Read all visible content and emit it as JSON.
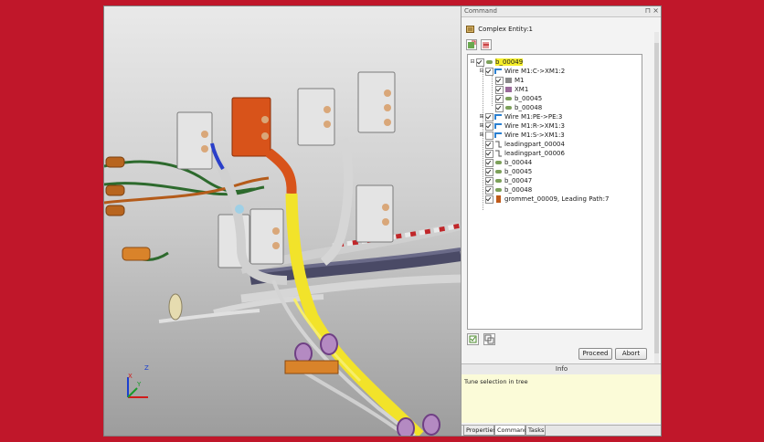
{
  "panel": {
    "title": "Command",
    "pin_icon": "pin-icon",
    "close_icon": "close-icon",
    "entity_label": "Complex Entity:1",
    "tree": [
      {
        "label": "b_00049",
        "selected": true
      },
      {
        "label": "Wire M1:C->XM1:2"
      },
      {
        "label": "M1"
      },
      {
        "label": "XM1"
      },
      {
        "label": "b_00045"
      },
      {
        "label": "b_00048"
      },
      {
        "label": "Wire M1:PE->PE:3"
      },
      {
        "label": "Wire M1:R->XM1:3"
      },
      {
        "label": "Wire M1:S->XM1:3"
      },
      {
        "label": "leadingpart_00004"
      },
      {
        "label": "leadingpart_00006"
      },
      {
        "label": "b_00044"
      },
      {
        "label": "b_00045"
      },
      {
        "label": "b_00047"
      },
      {
        "label": "b_00048"
      },
      {
        "label": "grommet_00009, Leading Path:7"
      }
    ],
    "proceed_label": "Proceed",
    "abort_label": "Abort",
    "info_title": "Info",
    "info_text": "Tune selection in tree",
    "tabs": [
      "Properties",
      "Command",
      "Tasks"
    ],
    "active_tab": "Command"
  },
  "viewport": {
    "axes": {
      "x": "X",
      "y": "Y",
      "z": "Z"
    },
    "colors": {
      "harness_yellow": "#f2e32a",
      "connector_orange": "#d8531a",
      "background_red": "#c0172a"
    }
  }
}
